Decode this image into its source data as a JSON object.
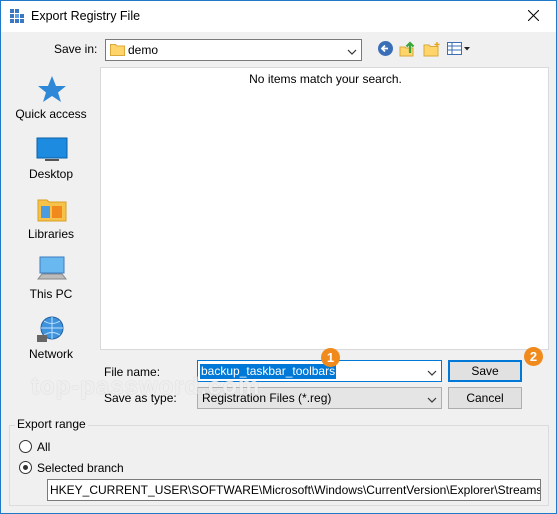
{
  "window": {
    "title": "Export Registry File",
    "icon": "registry-editor-icon",
    "accent": "#0078d7"
  },
  "save_in": {
    "label": "Save in:",
    "value": "demo"
  },
  "places": [
    {
      "label": "Quick access",
      "icon": "quick-access-star-icon"
    },
    {
      "label": "Desktop",
      "icon": "desktop-icon"
    },
    {
      "label": "Libraries",
      "icon": "libraries-icon"
    },
    {
      "label": "This PC",
      "icon": "this-pc-icon"
    },
    {
      "label": "Network",
      "icon": "network-icon"
    }
  ],
  "file_list": {
    "empty_message": "No items match your search."
  },
  "file_name": {
    "label": "File name:",
    "value": "backup_taskbar_toolbars"
  },
  "save_as_type": {
    "label": "Save as type:",
    "value": "Registration Files (*.reg)"
  },
  "buttons": {
    "save": "Save",
    "cancel": "Cancel"
  },
  "badges": {
    "one": "1",
    "two": "2",
    "color": "#f08a1c"
  },
  "watermark": "top-password.com",
  "export_range": {
    "title": "Export range",
    "all_label": "All",
    "selected_label": "Selected branch",
    "selected": "selected_branch",
    "branch_path": "HKEY_CURRENT_USER\\SOFTWARE\\Microsoft\\Windows\\CurrentVersion\\Explorer\\Streams\\Deskto"
  }
}
